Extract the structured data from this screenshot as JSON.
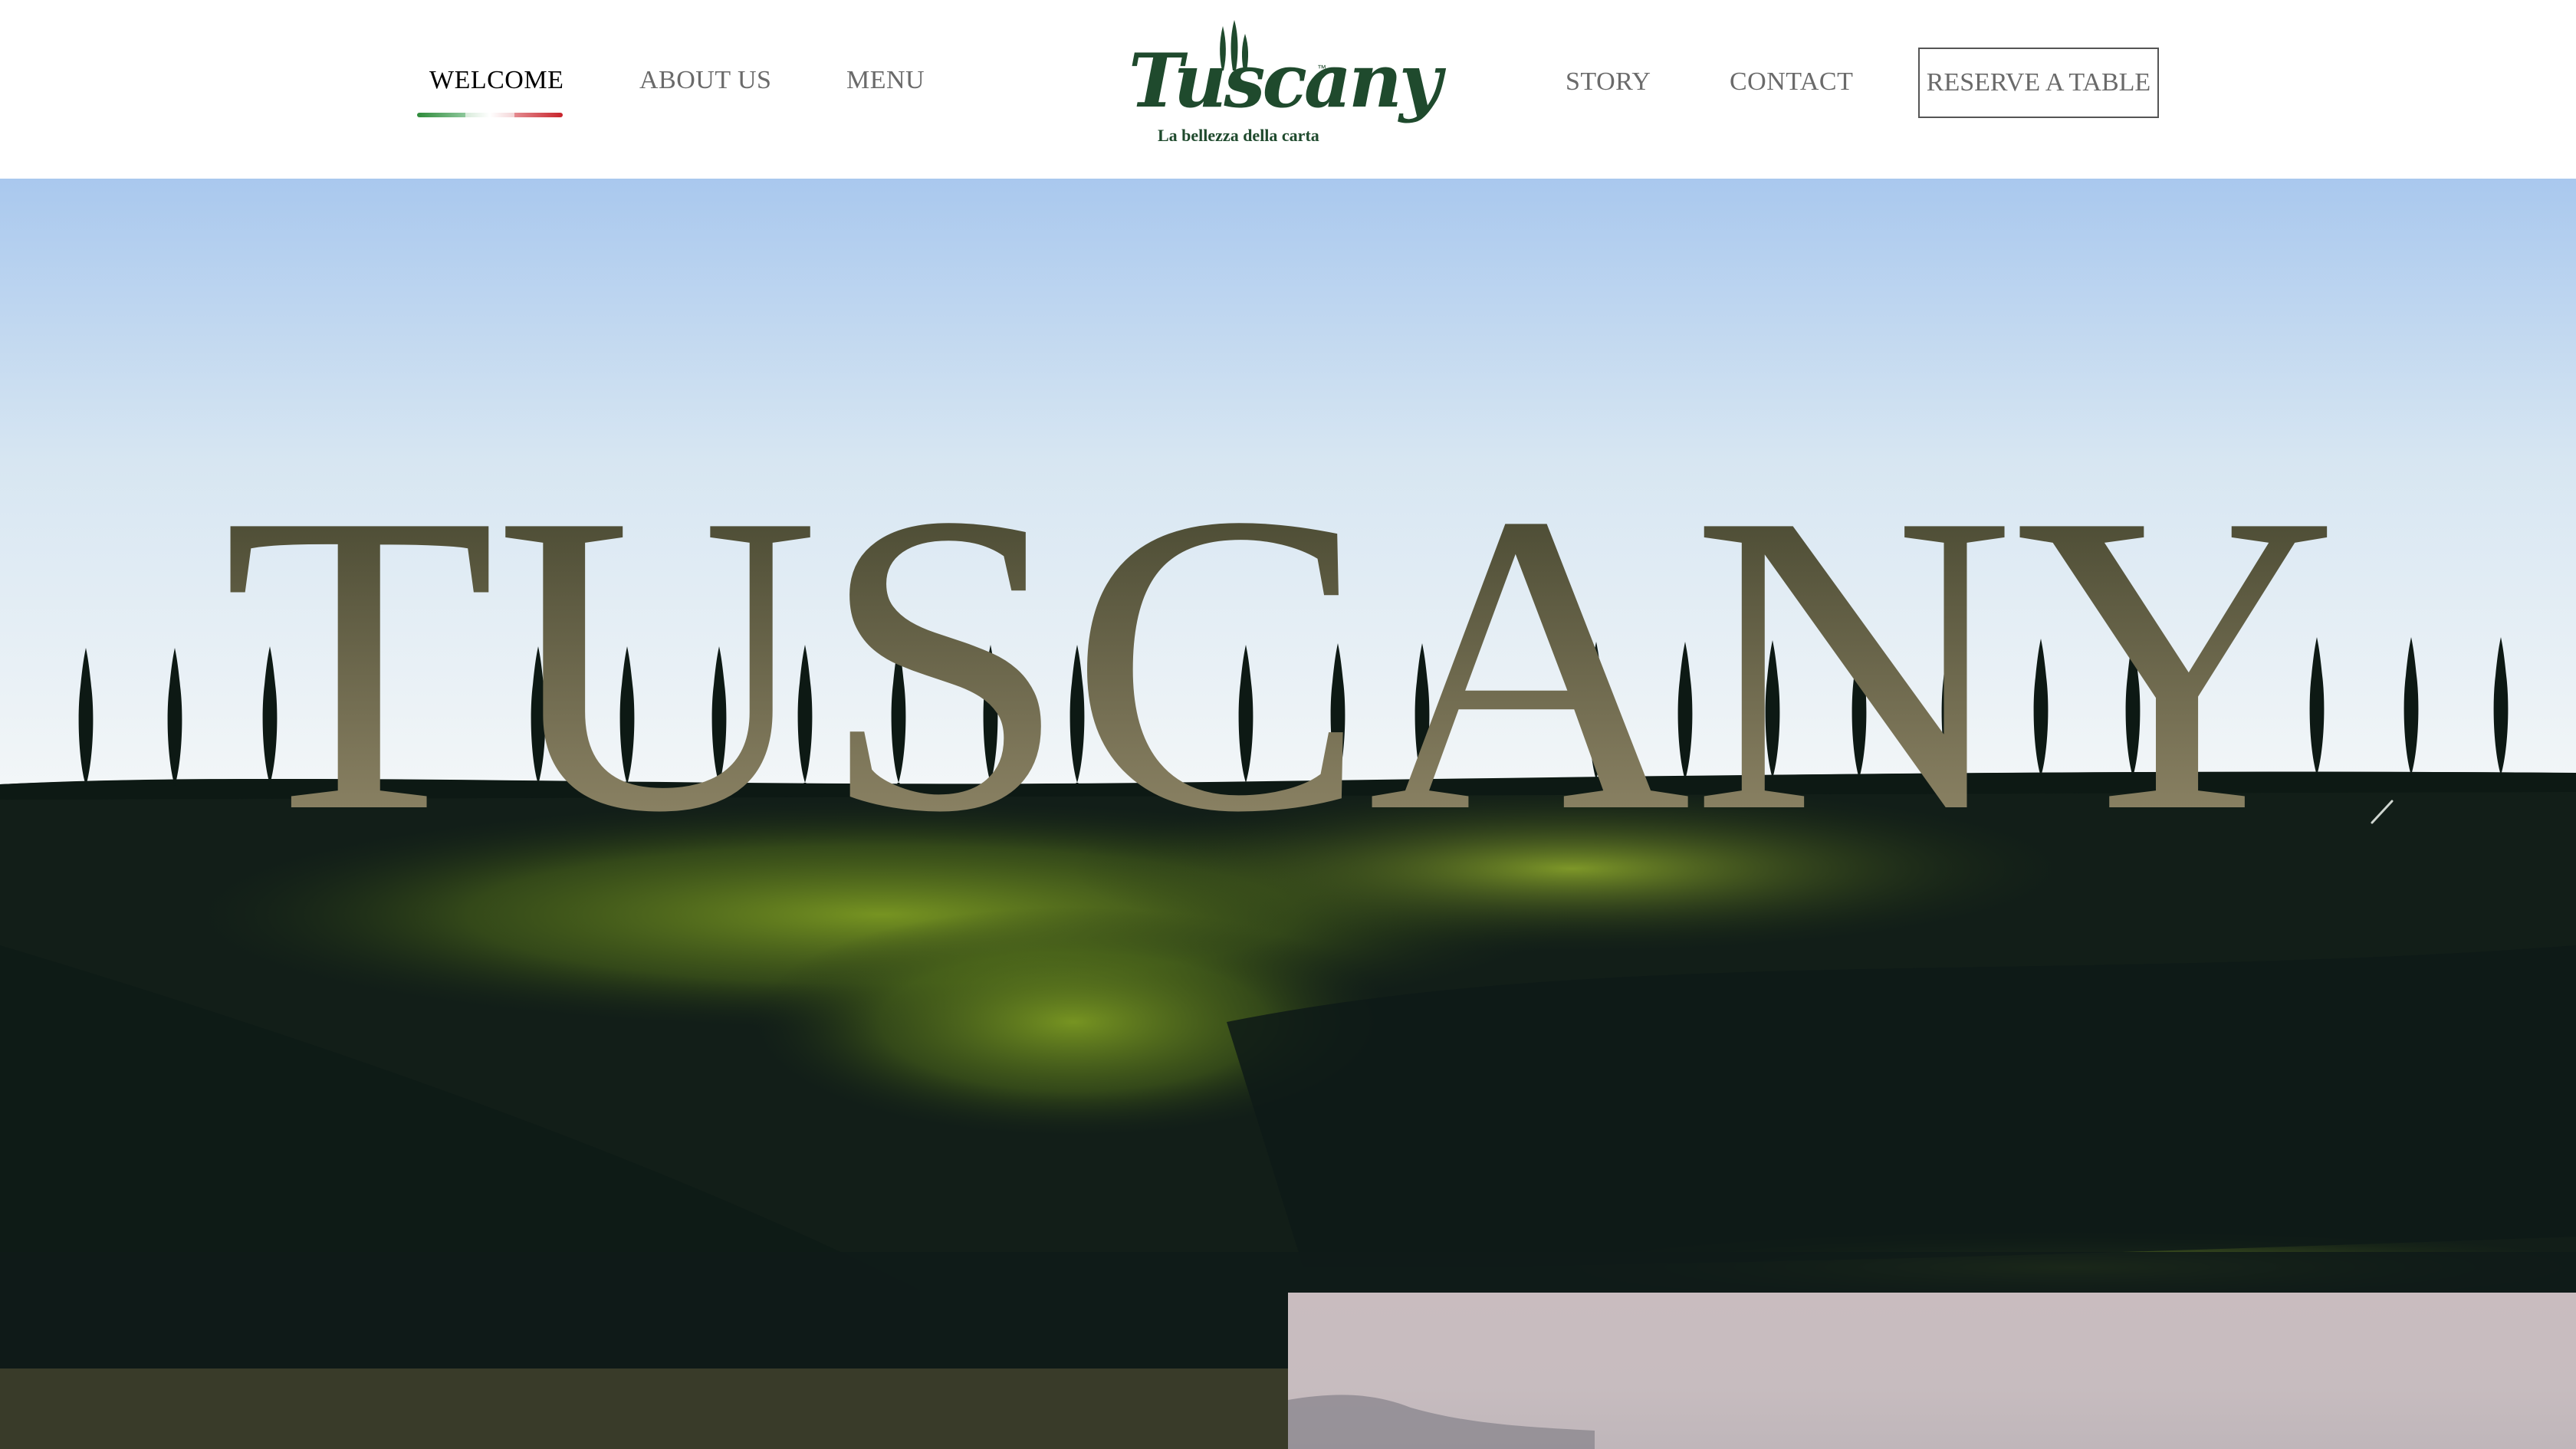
{
  "nav": {
    "left_items": [
      {
        "label": "WELCOME",
        "active": true
      },
      {
        "label": "ABOUT US",
        "active": false
      },
      {
        "label": "MENU",
        "active": false
      }
    ],
    "right_items": [
      {
        "label": "STORY"
      },
      {
        "label": "CONTACT"
      }
    ],
    "reserve_label": "RESERVE A TABLE",
    "active_underline_colors": [
      "#2e8b3a",
      "#ffffff",
      "#c8232b"
    ]
  },
  "logo": {
    "wordmark": "Tuscany",
    "trademark": "™",
    "tagline": "La bellezza della carta",
    "color": "#1f4a2d"
  },
  "hero": {
    "title": "TUSCANY",
    "title_color_top": "#3b3d27",
    "title_color_bottom": "#9b9070",
    "sky_top": "#a9c8ee",
    "sky_bottom": "#f2f6f8",
    "field_color": "#0f1a15",
    "highlight_color": "#6f8a1e"
  },
  "sections": {
    "left_panel_color": "#393b29",
    "right_panel_color": "#c9bcbf"
  }
}
